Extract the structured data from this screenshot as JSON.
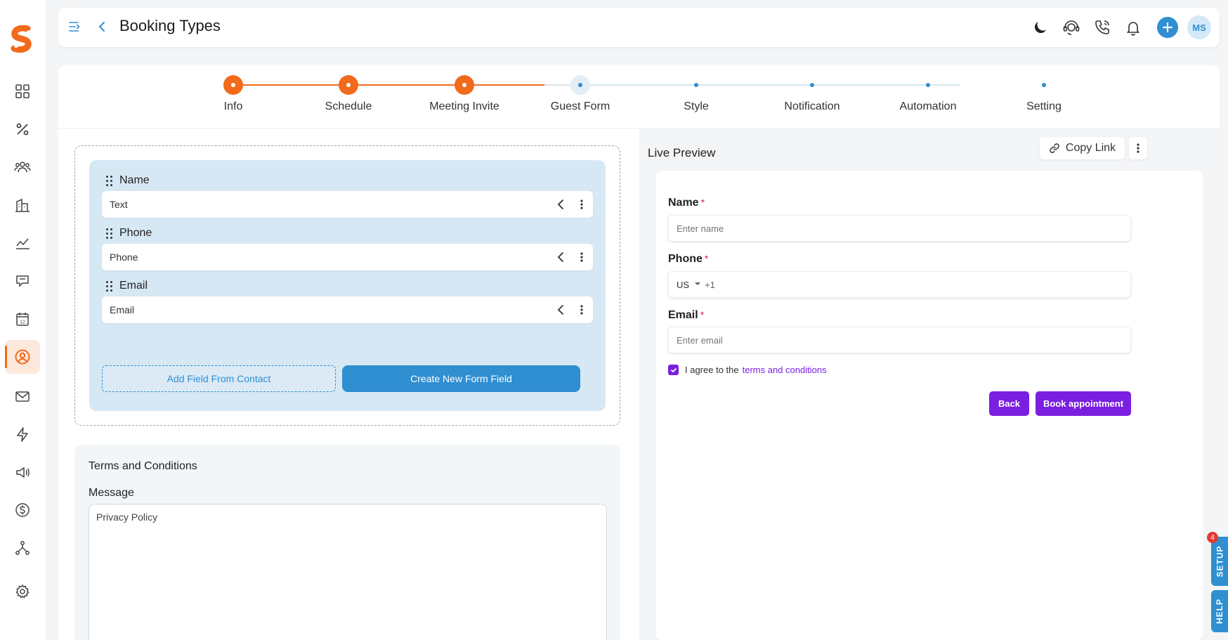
{
  "app": {
    "page_title": "Booking Types",
    "user_initials": "MS"
  },
  "sidebar": {
    "items": [
      {
        "icon": "grid-icon",
        "label": "Dashboard"
      },
      {
        "icon": "percent-icon",
        "label": "Deals"
      },
      {
        "icon": "users-icon",
        "label": "Contacts"
      },
      {
        "icon": "building-icon",
        "label": "Companies"
      },
      {
        "icon": "chart-line-icon",
        "label": "Reports"
      },
      {
        "icon": "chat-icon",
        "label": "Conversations"
      },
      {
        "icon": "calendar-icon",
        "label": "Calendar",
        "day": "12"
      },
      {
        "icon": "contact-circle-icon",
        "label": "Booking",
        "active": true
      },
      {
        "icon": "mail-icon",
        "label": "Email"
      },
      {
        "icon": "lightning-icon",
        "label": "Automation"
      },
      {
        "icon": "megaphone-icon",
        "label": "Campaigns"
      },
      {
        "icon": "dollar-icon",
        "label": "Billing"
      },
      {
        "icon": "hierarchy-icon",
        "label": "Workflows"
      },
      {
        "icon": "gear-icon",
        "label": "Settings"
      }
    ]
  },
  "stepper": {
    "steps": [
      {
        "label": "Info",
        "state": "done"
      },
      {
        "label": "Schedule",
        "state": "done"
      },
      {
        "label": "Meeting Invite",
        "state": "done"
      },
      {
        "label": "Guest Form",
        "state": "current"
      },
      {
        "label": "Style",
        "state": "todo"
      },
      {
        "label": "Notification",
        "state": "todo"
      },
      {
        "label": "Automation",
        "state": "todo"
      },
      {
        "label": "Setting",
        "state": "todo"
      }
    ]
  },
  "builder": {
    "fields": [
      {
        "label": "Name",
        "type": "Text"
      },
      {
        "label": "Phone",
        "type": "Phone"
      },
      {
        "label": "Email",
        "type": "Email"
      }
    ],
    "add_from_contact": "Add Field From Contact",
    "create_new": "Create New Form Field"
  },
  "terms": {
    "title": "Terms and Conditions",
    "message_label": "Message",
    "message_value": "Privacy Policy"
  },
  "preview": {
    "title": "Live Preview",
    "copy_link": "Copy Link",
    "name_label": "Name",
    "name_placeholder": "Enter name",
    "phone_label": "Phone",
    "phone_country": "US",
    "phone_prefix": "+1",
    "email_label": "Email",
    "email_placeholder": "Enter email",
    "required_mark": "*",
    "agree_text": "I agree to the",
    "terms_link": "terms and conditions",
    "back_button": "Back",
    "book_button": "Book appointment"
  },
  "floating": {
    "setup_label": "SETUP",
    "setup_badge": "4",
    "help_label": "HELP"
  },
  "colors": {
    "brand_orange": "#f26a1b",
    "primary_blue": "#2f8fd1",
    "purple": "#7a1fe0"
  }
}
